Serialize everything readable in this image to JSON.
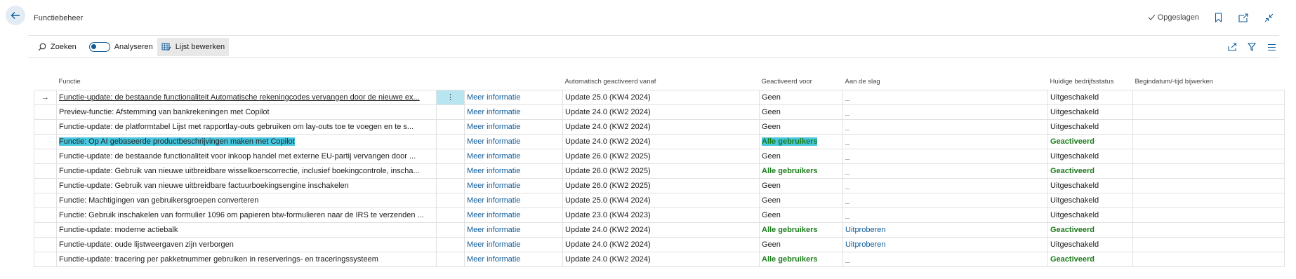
{
  "page": {
    "title": "Functiebeheer"
  },
  "header": {
    "saved_label": "Opgeslagen"
  },
  "actions": {
    "search": "Zoeken",
    "analyze": "Analyseren",
    "edit_list": "Lijst bewerken"
  },
  "columns": {
    "functie": "Functie",
    "auto": "Automatisch geactiveerd vanaf",
    "geactiveerd": "Geactiveerd voor",
    "aan_de_slag": "Aan de slag",
    "status": "Huidige bedrijfsstatus",
    "begindatum": "Begindatum/-tijd bijwerken"
  },
  "rows": [
    {
      "functie": "Functie-update: de bestaande functionaliteit Automatische rekeningcodes vervangen door de nieuwe ex...",
      "meer": "Meer informatie",
      "auto": "Update 25.0 (KW4 2024)",
      "geactiveerd": "Geen",
      "aan": "_",
      "status": "Uitgeschakeld",
      "begin": ""
    },
    {
      "functie": "Preview-functie: Afstemming van bankrekeningen met Copilot",
      "meer": "Meer informatie",
      "auto": "Update 24.0 (KW2 2024)",
      "geactiveerd": "Geen",
      "aan": "_",
      "status": "Uitgeschakeld",
      "begin": ""
    },
    {
      "functie": "Functie-update: de platformtabel Lijst met rapportlay-outs gebruiken om lay-outs toe te voegen en te s...",
      "meer": "Meer informatie",
      "auto": "Update 24.0 (KW2 2024)",
      "geactiveerd": "Geen",
      "aan": "_",
      "status": "Uitgeschakeld",
      "begin": ""
    },
    {
      "functie": "Functie: Op AI gebaseerde productbeschrijvingen maken met Copilot",
      "meer": "Meer informatie",
      "auto": "Update 24.0 (KW2 2024)",
      "geactiveerd": "Alle gebruikers",
      "aan": "_",
      "status": "Geactiveerd",
      "begin": ""
    },
    {
      "functie": "Functie-update: de bestaande functionaliteit voor inkoop handel met externe EU-partij vervangen door ...",
      "meer": "Meer informatie",
      "auto": "Update 26.0 (KW2 2025)",
      "geactiveerd": "Geen",
      "aan": "_",
      "status": "Uitgeschakeld",
      "begin": ""
    },
    {
      "functie": "Functie-update: Gebruik van nieuwe uitbreidbare wisselkoerscorrectie, inclusief boekingcontrole, inscha...",
      "meer": "Meer informatie",
      "auto": "Update 26.0 (KW2 2025)",
      "geactiveerd": "Alle gebruikers",
      "aan": "_",
      "status": "Geactiveerd",
      "begin": ""
    },
    {
      "functie": "Functie-update: Gebruik van nieuwe uitbreidbare factuurboekingsengine inschakelen",
      "meer": "Meer informatie",
      "auto": "Update 26.0 (KW2 2025)",
      "geactiveerd": "Geen",
      "aan": "_",
      "status": "Uitgeschakeld",
      "begin": ""
    },
    {
      "functie": "Functie: Machtigingen van gebruikersgroepen converteren",
      "meer": "Meer informatie",
      "auto": "Update 25.0 (KW4 2024)",
      "geactiveerd": "Geen",
      "aan": "_",
      "status": "Uitgeschakeld",
      "begin": ""
    },
    {
      "functie": "Functie: Gebruik inschakelen van formulier 1096 om papieren btw-formulieren naar de IRS te verzenden ...",
      "meer": "Meer informatie",
      "auto": "Update 23.0 (KW4 2023)",
      "geactiveerd": "Geen",
      "aan": "_",
      "status": "Uitgeschakeld",
      "begin": ""
    },
    {
      "functie": "Functie-update: moderne actiebalk",
      "meer": "Meer informatie",
      "auto": "Update 24.0 (KW2 2024)",
      "geactiveerd": "Alle gebruikers",
      "aan": "Uitproberen",
      "status": "Geactiveerd",
      "begin": ""
    },
    {
      "functie": "Functie-update: oude lijstweergaven zijn verborgen",
      "meer": "Meer informatie",
      "auto": "Update 24.0 (KW2 2024)",
      "geactiveerd": "Geen",
      "aan": "Uitproberen",
      "status": "Uitgeschakeld",
      "begin": ""
    },
    {
      "functie": "Functie-update: tracering per pakketnummer gebruiken in reserverings- en traceringssysteem",
      "meer": "Meer informatie",
      "auto": "Update 24.0 (KW2 2024)",
      "geactiveerd": "Alle gebruikers",
      "aan": "_",
      "status": "Geactiveerd",
      "begin": ""
    }
  ],
  "selected_row": 0,
  "highlighted_row": 3,
  "colors": {
    "accent": "#0f5c99",
    "green": "#1b7d1b",
    "highlight": "#48c8e0"
  }
}
